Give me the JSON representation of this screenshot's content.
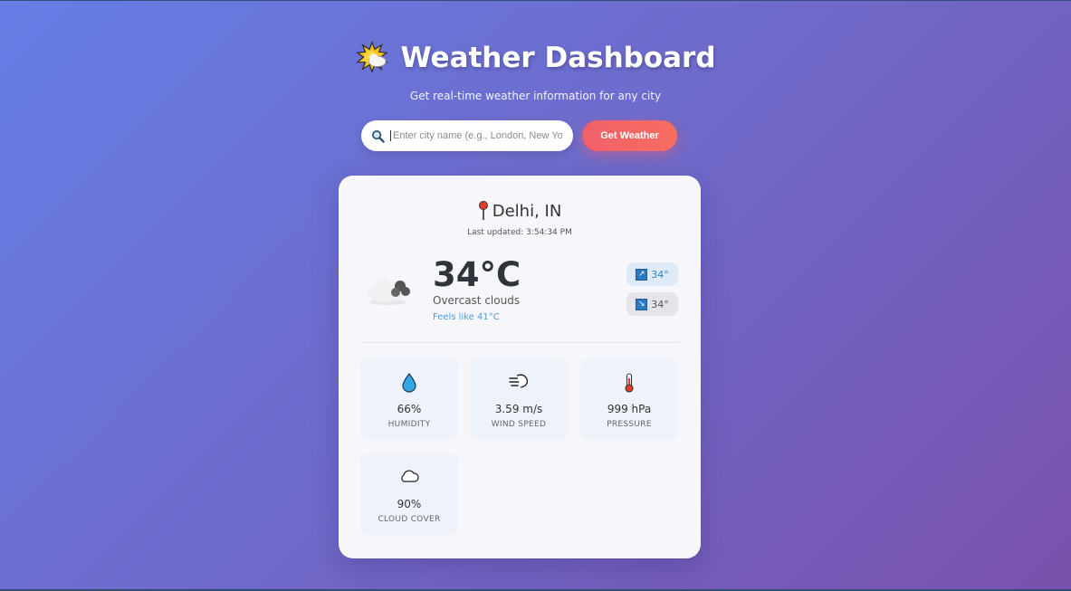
{
  "header": {
    "title": "Weather Dashboard",
    "title_icon": "sun-behind-cloud-icon",
    "subtitle": "Get real-time weather information for any city"
  },
  "search": {
    "placeholder": "Enter city name (e.g., London, New York)",
    "value": "",
    "icon": "search-icon",
    "button_label": "Get Weather"
  },
  "weather": {
    "location": "Delhi, IN",
    "location_icon": "pin-icon",
    "last_updated": "Last updated: 3:54:34 PM",
    "condition_icon": "cloud-icon",
    "temperature": "34°C",
    "description": "Overcast clouds",
    "feels_like": "Feels like 41°C",
    "max_temp": "34°",
    "min_temp": "34°",
    "max_icon": "arrow-up-right-icon",
    "min_icon": "arrow-down-right-icon"
  },
  "stats": [
    {
      "icon": "droplet-icon",
      "value": "66%",
      "label": "HUMIDITY"
    },
    {
      "icon": "wind-icon",
      "value": "3.59 m/s",
      "label": "WIND SPEED"
    },
    {
      "icon": "thermometer-icon",
      "value": "999 hPa",
      "label": "PRESSURE"
    },
    {
      "icon": "cloud-icon",
      "value": "90%",
      "label": "CLOUD COVER"
    }
  ],
  "colors": {
    "accent_button": "#f25f69",
    "feels_like": "#4a9fe0",
    "max_pill": "#dfeaf8",
    "min_pill": "#e4e4ea"
  }
}
